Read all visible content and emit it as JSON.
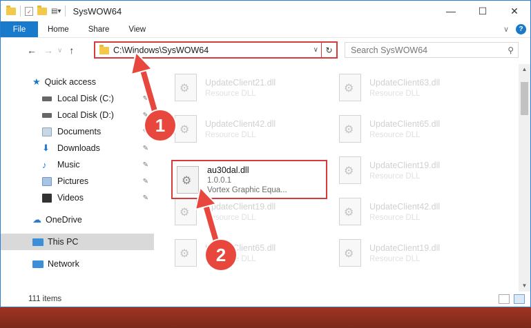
{
  "window": {
    "title": "SysWOW64",
    "controls": {
      "minimize": "—",
      "maximize": "☐",
      "close": "✕"
    }
  },
  "ribbon": {
    "tabs": [
      "File",
      "Home",
      "Share",
      "View"
    ],
    "expand": "∨",
    "help": "?"
  },
  "nav": {
    "back": "←",
    "forward": "→",
    "recent": "∨",
    "up": "↑",
    "address": "C:\\Windows\\SysWOW64",
    "address_dropdown": "∨",
    "refresh": "↻",
    "search_placeholder": "Search SysWOW64",
    "search_icon": "⚲"
  },
  "sidebar": {
    "items": [
      {
        "label": "Quick access",
        "icon": "star-icon",
        "color": "#1979ca"
      },
      {
        "label": "Local Disk (C:)",
        "icon": "drive-icon",
        "color": "#5a5a5a",
        "pinned": true
      },
      {
        "label": "Local Disk (D:)",
        "icon": "drive-icon",
        "color": "#5a5a5a",
        "pinned": true
      },
      {
        "label": "Documents",
        "icon": "documents-icon",
        "color": "#8aa3bf",
        "pinned": true
      },
      {
        "label": "Downloads",
        "icon": "downloads-icon",
        "color": "#2a7bd0",
        "pinned": true
      },
      {
        "label": "Music",
        "icon": "music-icon",
        "color": "#2a7bd0",
        "pinned": true
      },
      {
        "label": "Pictures",
        "icon": "pictures-icon",
        "color": "#6e98c8",
        "pinned": true
      },
      {
        "label": "Videos",
        "icon": "videos-icon",
        "color": "#333333",
        "pinned": true
      },
      {
        "label": "OneDrive",
        "icon": "cloud-icon",
        "color": "#2a7bd0"
      },
      {
        "label": "This PC",
        "icon": "pc-icon",
        "color": "#3b8fd9"
      },
      {
        "label": "Network",
        "icon": "network-icon",
        "color": "#3b8fd9"
      }
    ],
    "pin_glyph": "📌"
  },
  "files": {
    "faded": [
      {
        "name": "UpdateClient21.dll",
        "type": "Resource DLL"
      },
      {
        "name": "UpdateClient63.dll",
        "type": "Resource DLL"
      },
      {
        "name": "UpdateClient42.dll",
        "type": "Resource DLL"
      },
      {
        "name": "UpdateClient65.dll",
        "type": "Resource DLL"
      },
      {
        "name": "UpdateClient19.dll",
        "type": "Resource DLL"
      },
      {
        "name": "UpdateClient19.dll",
        "type": "Resource DLL"
      },
      {
        "name": "UpdateClient42.dll",
        "type": "Resource DLL"
      },
      {
        "name": "UpdateClient65.dll",
        "type": "Resource DLL"
      },
      {
        "name": "UpdateClient19.dll",
        "type": "Resource DLL"
      }
    ],
    "selected": {
      "name": "au30dal.dll",
      "version": "1.0.0.1",
      "description": "Vortex Graphic Equa..."
    }
  },
  "status": {
    "count": "111 items"
  },
  "callouts": [
    "1",
    "2"
  ],
  "colors": {
    "accent": "#1979ca",
    "highlight": "#d63a3a",
    "callout": "#e8473e"
  }
}
